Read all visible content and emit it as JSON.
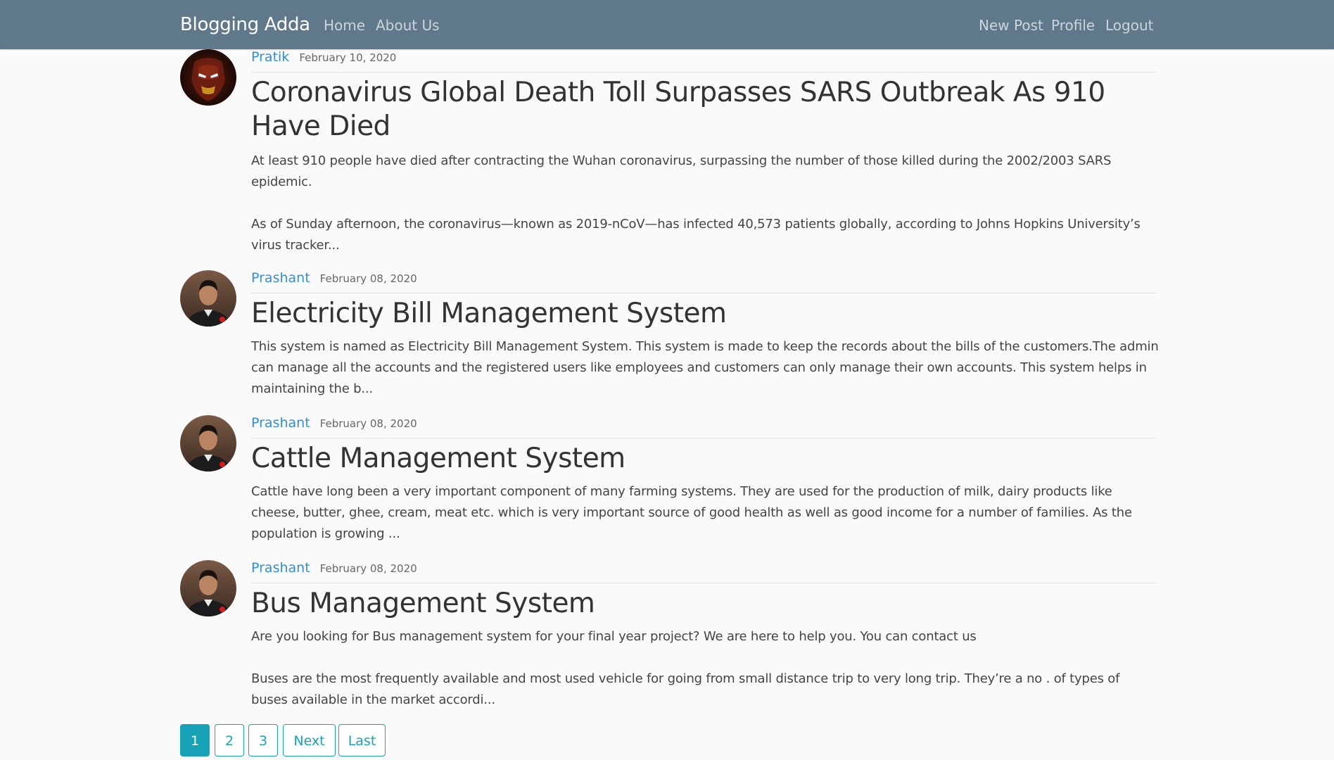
{
  "nav": {
    "brand": "Blogging Adda",
    "left_links": [
      "Home",
      "About Us"
    ],
    "right_links": [
      "New Post",
      "Profile",
      "Logout"
    ]
  },
  "posts": [
    {
      "author": "Pratik",
      "date": "February 10, 2020",
      "title": "Coronavirus Global Death Toll Surpasses SARS Outbreak As 910 Have Died",
      "paragraphs": [
        "At least 910 people have died after contracting the Wuhan coronavirus, surpassing the number of those killed during the 2002/2003 SARS epidemic.",
        "As of Sunday afternoon, the coronavirus—known as 2019-nCoV—has infected 40,573 patients globally, according to Johns Hopkins University’s virus tracker..."
      ],
      "avatar_icon": "ironman-avatar"
    },
    {
      "author": "Prashant",
      "date": "February 08, 2020",
      "title": "Electricity Bill Management System",
      "paragraphs": [
        "This system is named as Electricity Bill Management System. This system is made to keep the records about the bills of the customers.The admin can manage all the accounts and the registered users like employees and customers can only manage their own accounts. This system helps in maintaining the b..."
      ],
      "avatar_icon": "person-avatar"
    },
    {
      "author": "Prashant",
      "date": "February 08, 2020",
      "title": "Cattle Management System",
      "paragraphs": [
        "Cattle have long been a very important component of many farming systems. They are used for the production of milk, dairy products like cheese, butter, ghee, cream, meat etc. which is very important source of good health as well as good income for a number of families. As the population is growing ..."
      ],
      "avatar_icon": "person-avatar"
    },
    {
      "author": "Prashant",
      "date": "February 08, 2020",
      "title": "Bus Management System",
      "paragraphs": [
        "Are you looking for Bus management system for your final year project? We are here to help you. You can contact us",
        "Buses are the most frequently available and most used vehicle for going from small distance trip to very long trip. They’re a no . of types of buses available in the market accordi..."
      ],
      "avatar_icon": "person-avatar"
    }
  ],
  "pagination": {
    "pages": [
      "1",
      "2",
      "3"
    ],
    "next": "Next",
    "last": "Last",
    "current": "1"
  },
  "colors": {
    "navbar": "#5f788a",
    "link": "#2f8fd8",
    "pager_accent": "#17a2b8"
  }
}
